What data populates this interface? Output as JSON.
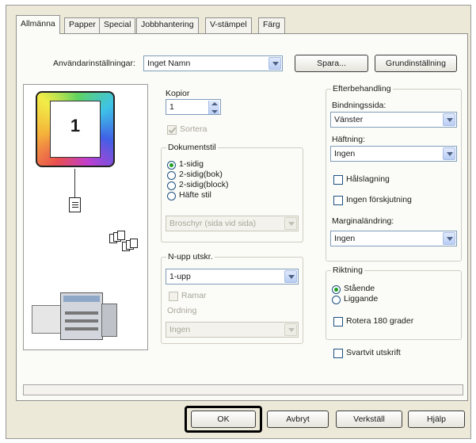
{
  "tabs": [
    {
      "label": "Allmänna",
      "active": true
    },
    {
      "label": "Papper"
    },
    {
      "label": "Special"
    },
    {
      "label": "Jobbhantering"
    },
    {
      "label": "V-stämpel"
    },
    {
      "label": "Färg"
    }
  ],
  "user_settings": {
    "label": "Användarinställningar:",
    "value": "Inget Namn",
    "save_label": "Spara...",
    "default_label": "Grundinställning"
  },
  "preview": {
    "page_number": "1"
  },
  "copies": {
    "label": "Kopior",
    "value": "1",
    "collate_label": "Sortera"
  },
  "document_style": {
    "title": "Dokumentstil",
    "options": [
      "1-sidig",
      "2-sidig(bok)",
      "2-sidig(block)",
      "Häfte stil"
    ],
    "selected": "1-sidig",
    "booklet_select": "Broschyr (sida vid sida)"
  },
  "n_up": {
    "title": "N-upp utskr.",
    "value": "1-upp",
    "border_label": "Ramar",
    "order_label": "Ordning",
    "order_value": "Ingen"
  },
  "finishing": {
    "title": "Efterbehandling",
    "binding_label": "Bindningssida:",
    "binding_value": "Vänster",
    "stapling_label": "Häftning:",
    "stapling_value": "Ingen",
    "punch_label": "Hålslagning",
    "no_offset_label": "Ingen förskjutning",
    "margin_label": "Marginaländring:",
    "margin_value": "Ingen"
  },
  "orientation": {
    "title": "Riktning",
    "portrait": "Stående",
    "landscape": "Liggande",
    "rotate_label": "Rotera 180 grader"
  },
  "bw_print_label": "Svartvit utskrift",
  "footer": {
    "ok": "OK",
    "cancel": "Avbryt",
    "apply": "Verkställ",
    "help": "Hjälp"
  },
  "colors": {
    "accent_highlight": "#000000",
    "radio_selected": "#20a020",
    "panel_bg": "#fbfbf7",
    "dialog_bg": "#ece9d8"
  }
}
